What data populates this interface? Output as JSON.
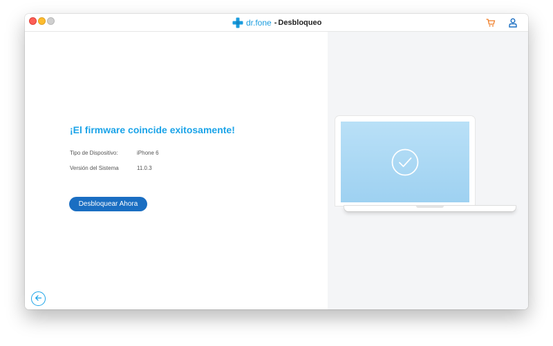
{
  "app": {
    "brand_name": "dr.fone",
    "separator": "-",
    "title": "Desbloqueo"
  },
  "main": {
    "heading": "¡El firmware coincide exitosamente!",
    "info": [
      {
        "label": "Tipo de Dispositivo:",
        "value": "iPhone 6"
      },
      {
        "label": "Versión del Sistema",
        "value": "11.0.3"
      }
    ],
    "unlock_button_label": "Desbloquear Ahora"
  },
  "icons": {
    "cart": "cart-icon",
    "user": "user-icon",
    "back": "back-arrow-icon",
    "check": "check-circle-icon",
    "brand": "plus-logo-icon"
  },
  "colors": {
    "brand_blue": "#1a9cde",
    "accent_orange": "#f07b22",
    "button_blue": "#1a6ec2",
    "heading_blue": "#1aa3e8"
  }
}
